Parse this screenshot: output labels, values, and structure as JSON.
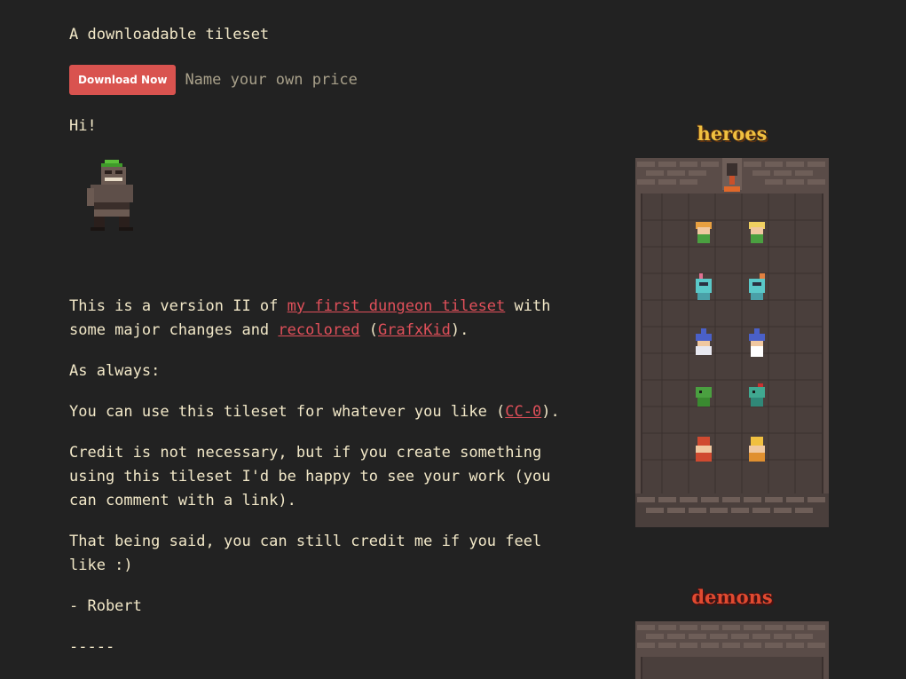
{
  "tagline": "A downloadable tileset",
  "buy": {
    "button_label": "Download Now",
    "price_label": "Name your own price"
  },
  "greeting": "Hi!",
  "body": {
    "p1_pre": "This is a version II of ",
    "p1_link1": "my first dungeon tileset",
    "p1_mid": " with some major changes and ",
    "p1_link2": "recolored",
    "p1_open": " (",
    "p1_link3": "GrafxKid",
    "p1_close": ").",
    "p2": "As always:",
    "p3_pre": "You can use this tileset for whatever you like (",
    "p3_link": "CC-0",
    "p3_post": ").",
    "p4": "Credit is not necessary, but if you create something using this tileset I'd be happy to see your work (you can comment with a link).",
    "p5": "That being said, you can still credit me if you feel like :)",
    "p6": "- Robert",
    "p7": "-----"
  },
  "gallery": {
    "heroes_title": "heroes",
    "demons_title": "demons"
  },
  "colors": {
    "background": "#222222",
    "text": "#f2e8c8",
    "link": "#e0505a",
    "button": "#d9534f"
  }
}
